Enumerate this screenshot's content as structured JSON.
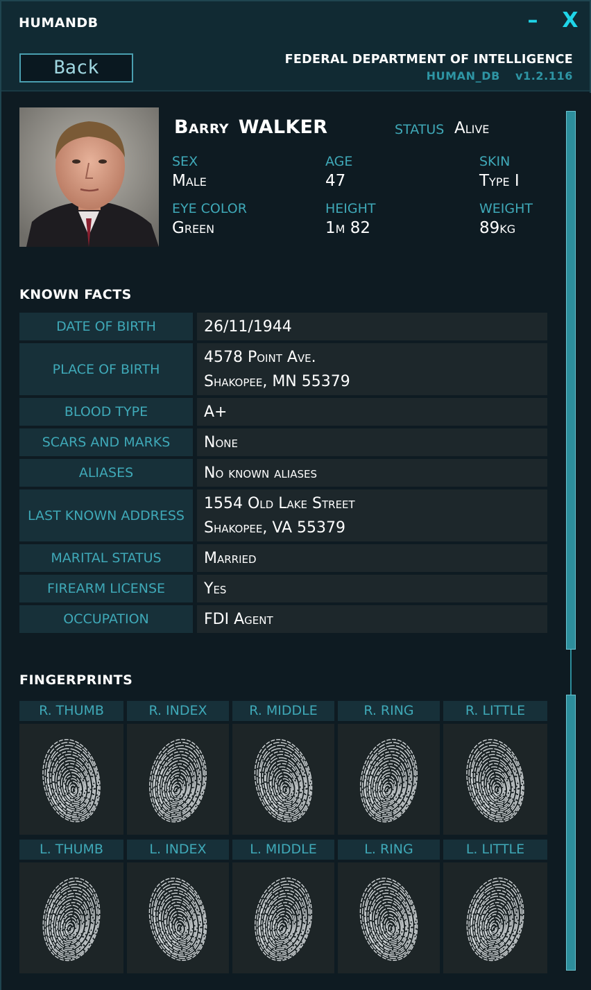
{
  "app": {
    "title": "HUMANDB",
    "minimize_glyph": "–",
    "close_glyph": "X"
  },
  "header": {
    "back_label": "Back",
    "agency": "FEDERAL DEPARTMENT OF INTELLIGENCE",
    "db_name": "HUMAN_DB",
    "version": "v1.2.116"
  },
  "profile": {
    "first_name": "Barry",
    "last_name": "WALKER",
    "status_label": "STATUS",
    "status_value": "Alive",
    "attributes": [
      {
        "label": "SEX",
        "value": "Male"
      },
      {
        "label": "AGE",
        "value": "47"
      },
      {
        "label": "SKIN",
        "value": "Type I"
      },
      {
        "label": "EYE COLOR",
        "value": "Green"
      },
      {
        "label": "HEIGHT",
        "value": "1m 82"
      },
      {
        "label": "WEIGHT",
        "value": "89kg"
      }
    ]
  },
  "known_facts": {
    "title": "KNOWN  FACTS",
    "rows": [
      {
        "label": "DATE OF BIRTH",
        "lines": [
          "26/11/1944"
        ]
      },
      {
        "label": "PLACE OF BIRTH",
        "lines": [
          "4578 Point Ave.",
          "Shakopee, MN 55379"
        ]
      },
      {
        "label": "BLOOD TYPE",
        "lines": [
          "A+"
        ]
      },
      {
        "label": "SCARS AND MARKS",
        "lines": [
          "None"
        ]
      },
      {
        "label": "ALIASES",
        "lines": [
          "No known aliases"
        ]
      },
      {
        "label": "LAST KNOWN ADDRESS",
        "lines": [
          "1554 Old Lake Street",
          "Shakopee, VA 55379"
        ]
      },
      {
        "label": "MARITAL STATUS",
        "lines": [
          "Married"
        ]
      },
      {
        "label": "FIREARM LICENSE",
        "lines": [
          "Yes"
        ]
      },
      {
        "label": "OCCUPATION",
        "lines": [
          "FDI Agent"
        ]
      }
    ]
  },
  "fingerprints": {
    "title": "FINGERPRINTS",
    "right": [
      "R. THUMB",
      "R. INDEX",
      "R. MIDDLE",
      "R. RING",
      "R. LITTLE"
    ],
    "left": [
      "L. THUMB",
      "L. INDEX",
      "L. MIDDLE",
      "L. RING",
      "L. LITTLE"
    ]
  },
  "colors": {
    "accent": "#3fa9b8",
    "close_button": "#1fd5e8",
    "panel": "#173039",
    "value_bg": "#1d272b"
  }
}
